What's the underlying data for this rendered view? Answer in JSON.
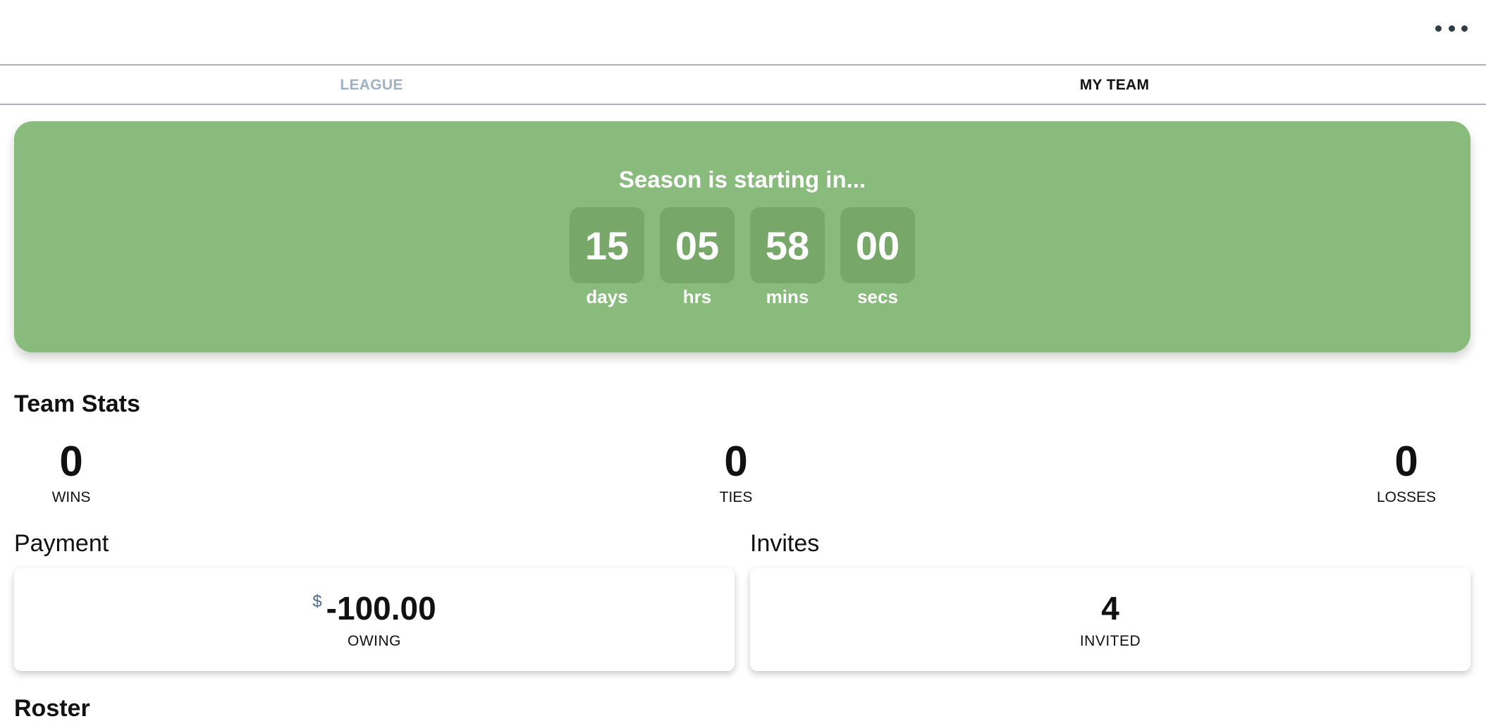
{
  "header": {
    "menu_icon": "more-horizontal-icon"
  },
  "tabs": [
    {
      "label": "LEAGUE",
      "active": false
    },
    {
      "label": "MY TEAM",
      "active": true
    }
  ],
  "countdown": {
    "title": "Season is starting in...",
    "units": [
      {
        "value": "15",
        "label": "days"
      },
      {
        "value": "05",
        "label": "hrs"
      },
      {
        "value": "58",
        "label": "mins"
      },
      {
        "value": "00",
        "label": "secs"
      }
    ],
    "bg_color": "#89bb7c"
  },
  "team_stats": {
    "title": "Team Stats",
    "wins": {
      "value": "0",
      "label": "WINS"
    },
    "ties": {
      "value": "0",
      "label": "TIES"
    },
    "losses": {
      "value": "0",
      "label": "LOSSES"
    }
  },
  "payment": {
    "title": "Payment",
    "currency": "$",
    "amount": "-100.00",
    "label": "OWING"
  },
  "invites": {
    "title": "Invites",
    "count": "4",
    "label": "INVITED"
  },
  "roster": {
    "title": "Roster"
  }
}
